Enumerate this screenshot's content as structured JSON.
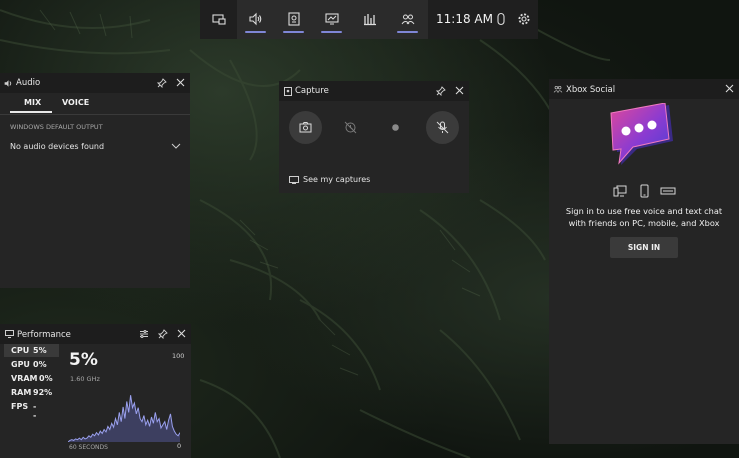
{
  "topbar": {
    "time": "11:18 AM",
    "buttons": [
      "widget-menu-icon",
      "audio-icon",
      "capture-icon",
      "performance-icon",
      "resources-icon",
      "xbox-social-icon"
    ],
    "right_icons": [
      "controller-icon",
      "settings-gear-icon"
    ],
    "accent": "#7f86d6"
  },
  "audio": {
    "title": "Audio",
    "tabs": [
      "MIX",
      "VOICE"
    ],
    "selected_tab": "MIX",
    "section_label": "WINDOWS DEFAULT OUTPUT",
    "device": "No audio devices found"
  },
  "capture": {
    "title": "Capture",
    "buttons": [
      "screenshot-icon",
      "record-last-icon",
      "record-icon",
      "mic-off-icon"
    ],
    "see_captures": "See my captures"
  },
  "performance": {
    "title": "Performance",
    "stats": [
      {
        "label": "CPU",
        "value": "5%"
      },
      {
        "label": "GPU",
        "value": "0%"
      },
      {
        "label": "VRAM",
        "value": "0%"
      },
      {
        "label": "RAM",
        "value": "92%"
      },
      {
        "label": "FPS",
        "value": "--"
      }
    ],
    "big_value": "5%",
    "frequency": "1.60 GHz",
    "max_label": "100",
    "min_label": "0",
    "x_label": "60 SECONDS"
  },
  "social": {
    "title": "Xbox Social",
    "message": "Sign in to use free voice and text chat with friends on PC, mobile, and Xbox",
    "button": "SIGN IN",
    "device_icons": [
      "pc-icon",
      "phone-icon",
      "console-icon"
    ]
  },
  "chart_data": {
    "type": "area",
    "x_range_seconds": 60,
    "ylim": [
      0,
      100
    ],
    "values": [
      0,
      2,
      3,
      2,
      4,
      3,
      5,
      3,
      6,
      4,
      5,
      8,
      6,
      10,
      8,
      12,
      9,
      14,
      11,
      16,
      13,
      20,
      16,
      24,
      19,
      30,
      22,
      38,
      26,
      45,
      30,
      52,
      38,
      60,
      44,
      50,
      36,
      44,
      30,
      26,
      34,
      22,
      28,
      20,
      32,
      24,
      38,
      26,
      30,
      18,
      22,
      26,
      16,
      28,
      36,
      20,
      14,
      10,
      8,
      12
    ]
  }
}
